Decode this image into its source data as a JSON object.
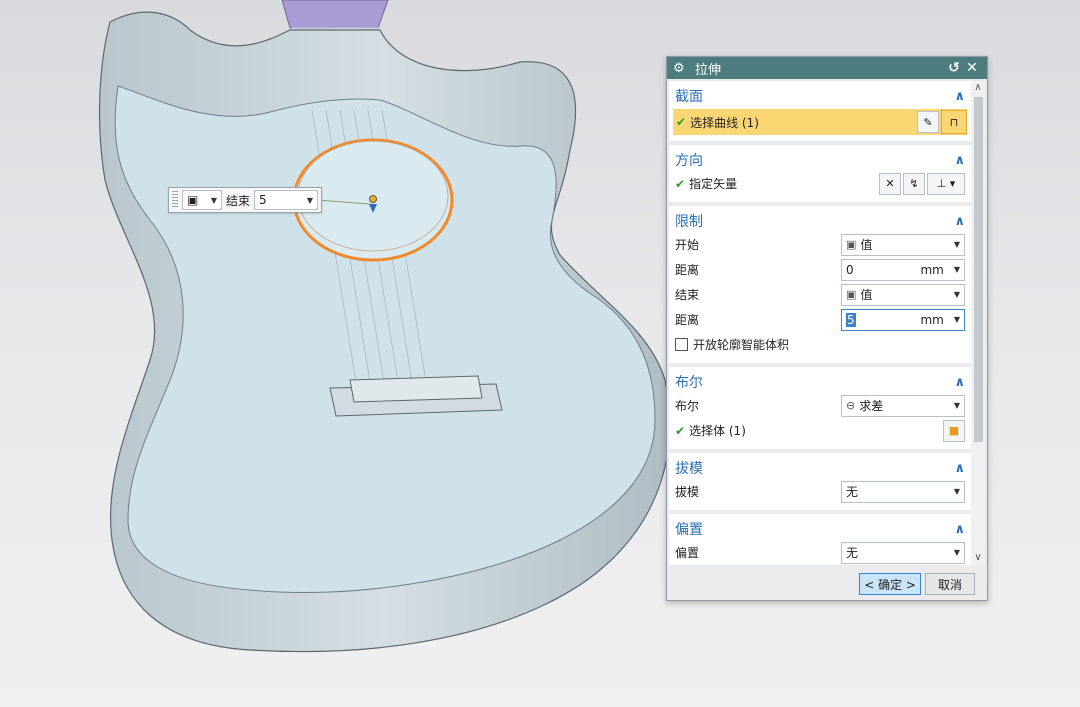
{
  "float_input": {
    "type_icon": "cube-value-icon",
    "label": "结束",
    "value": "5"
  },
  "dialog": {
    "title": "拉伸",
    "reset_icon": "reset-icon",
    "close_icon": "close-icon",
    "sections": {
      "section": {
        "title": "截面",
        "select_curve": "选择曲线 (1)"
      },
      "direction": {
        "title": "方向",
        "specify_vector": "指定矢量"
      },
      "limits": {
        "title": "限制",
        "start_label": "开始",
        "start_value": "值",
        "start_distance_label": "距离",
        "start_distance": "0",
        "start_unit": "mm",
        "end_label": "结束",
        "end_value": "值",
        "end_distance_label": "距离",
        "end_distance": "5",
        "end_unit": "mm",
        "open_profile_label": "开放轮廓智能体积"
      },
      "boolean": {
        "title": "布尔",
        "bool_label": "布尔",
        "bool_value": "求差",
        "select_body": "选择体 (1)"
      },
      "draft": {
        "title": "拔模",
        "draft_label": "拔模",
        "draft_value": "无"
      },
      "offset": {
        "title": "偏置",
        "offset_label": "偏置",
        "offset_value": "无"
      }
    },
    "ok_label": "< 确定 >",
    "cancel_label": "取消"
  },
  "colors": {
    "titlebar": "#4d7c7e",
    "highlight": "#fbd774",
    "section_title": "#2a6fb5",
    "model_face": "#cfe2ea",
    "sound_hole_edge": "#f08a2c"
  }
}
